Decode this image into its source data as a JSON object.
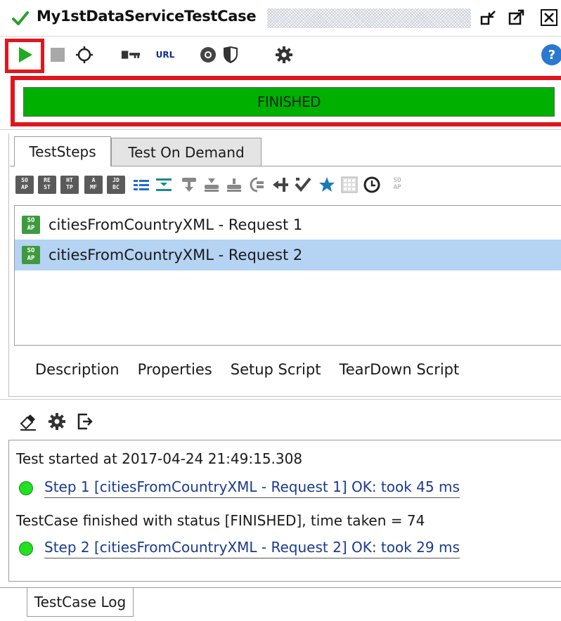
{
  "window": {
    "title": "My1stDataServiceTestCase",
    "title_icon": "check-icon",
    "controls": [
      "restore-icon",
      "popout-icon",
      "close-icon"
    ]
  },
  "toolbar": {
    "icons": [
      "run-icon",
      "stop-icon",
      "loadtest-icon",
      "key-value-icon",
      "url-icon",
      "monitor-icon",
      "security-icon",
      "settings-icon",
      "help-icon"
    ],
    "url_label": "URL",
    "help_label": "?"
  },
  "status": {
    "text": "FINISHED",
    "progress": 1.0,
    "color": "#00b000"
  },
  "tabs": [
    {
      "label": "TestSteps",
      "active": true
    },
    {
      "label": "Test On Demand",
      "active": false
    }
  ],
  "steptools": {
    "icons": [
      {
        "name": "soap-step-icon",
        "text": "SO\nAP"
      },
      {
        "name": "rest-step-icon",
        "text": "RE\nST"
      },
      {
        "name": "http-step-icon",
        "text": "HT\nTP"
      },
      {
        "name": "amf-step-icon",
        "text": "A\nMF"
      },
      {
        "name": "jdbc-step-icon",
        "text": "JD\nBC"
      }
    ]
  },
  "steps": [
    {
      "label": "citiesFromCountryXML - Request 1",
      "selected": false
    },
    {
      "label": "citiesFromCountryXML - Request 2",
      "selected": true
    }
  ],
  "subtabs": [
    "Description",
    "Properties",
    "Setup Script",
    "TearDown Script"
  ],
  "log": {
    "started": "Test started at 2017-04-24 21:49:15.308",
    "step1": "Step 1 [citiesFromCountryXML - Request 1] OK: took 45 ms",
    "finished": "TestCase finished with status [FINISHED], time taken = 74",
    "step2": "Step 2 [citiesFromCountryXML - Request 2] OK: took 29 ms"
  },
  "bottom_tab": "TestCase Log",
  "colors": {
    "highlight": "#e0161e",
    "selection": "#b5d3f3",
    "ok_dot": "#22e022"
  }
}
